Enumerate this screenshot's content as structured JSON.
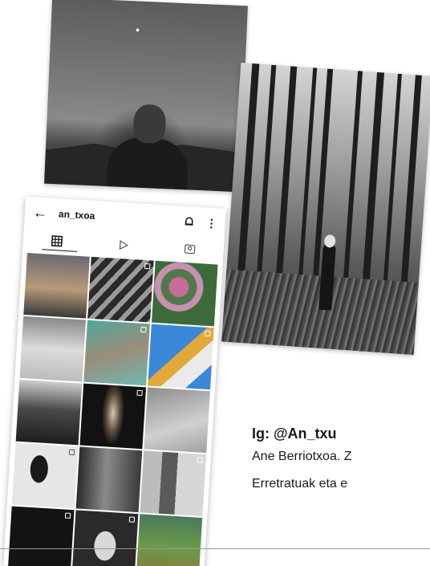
{
  "profile": {
    "username": "an_txoa",
    "back_icon": "arrow-left-icon",
    "notification_icon": "bell-icon",
    "more_icon": "more-vertical-icon",
    "tabs": [
      "grid-icon",
      "reels-play-icon",
      "tagged-icon"
    ],
    "grid_tiles": [
      {
        "name": "sunset-street",
        "multi": false
      },
      {
        "name": "window-shadows",
        "multi": true
      },
      {
        "name": "pink-flowers",
        "multi": false
      },
      {
        "name": "grey-sea",
        "multi": false
      },
      {
        "name": "teal-figures",
        "multi": true
      },
      {
        "name": "building-blue-sky",
        "multi": true
      },
      {
        "name": "film-crew",
        "multi": false
      },
      {
        "name": "dark-light-beam",
        "multi": true
      },
      {
        "name": "grey-dunes",
        "multi": false
      },
      {
        "name": "woman-portrait",
        "multi": true
      },
      {
        "name": "blur-legs",
        "multi": false
      },
      {
        "name": "room-mirror",
        "multi": true
      },
      {
        "name": "dark-tile",
        "multi": true
      },
      {
        "name": "sunglasses-portrait",
        "multi": true
      },
      {
        "name": "green-field",
        "multi": false
      }
    ]
  },
  "caption": {
    "handle": "Ig: @An_txu",
    "line1": "Ane Berriotxoa. Z",
    "line2": "Erretratuak eta e"
  },
  "colors": {
    "text": "#1a1a1a",
    "rule": "#9a9a9a"
  }
}
